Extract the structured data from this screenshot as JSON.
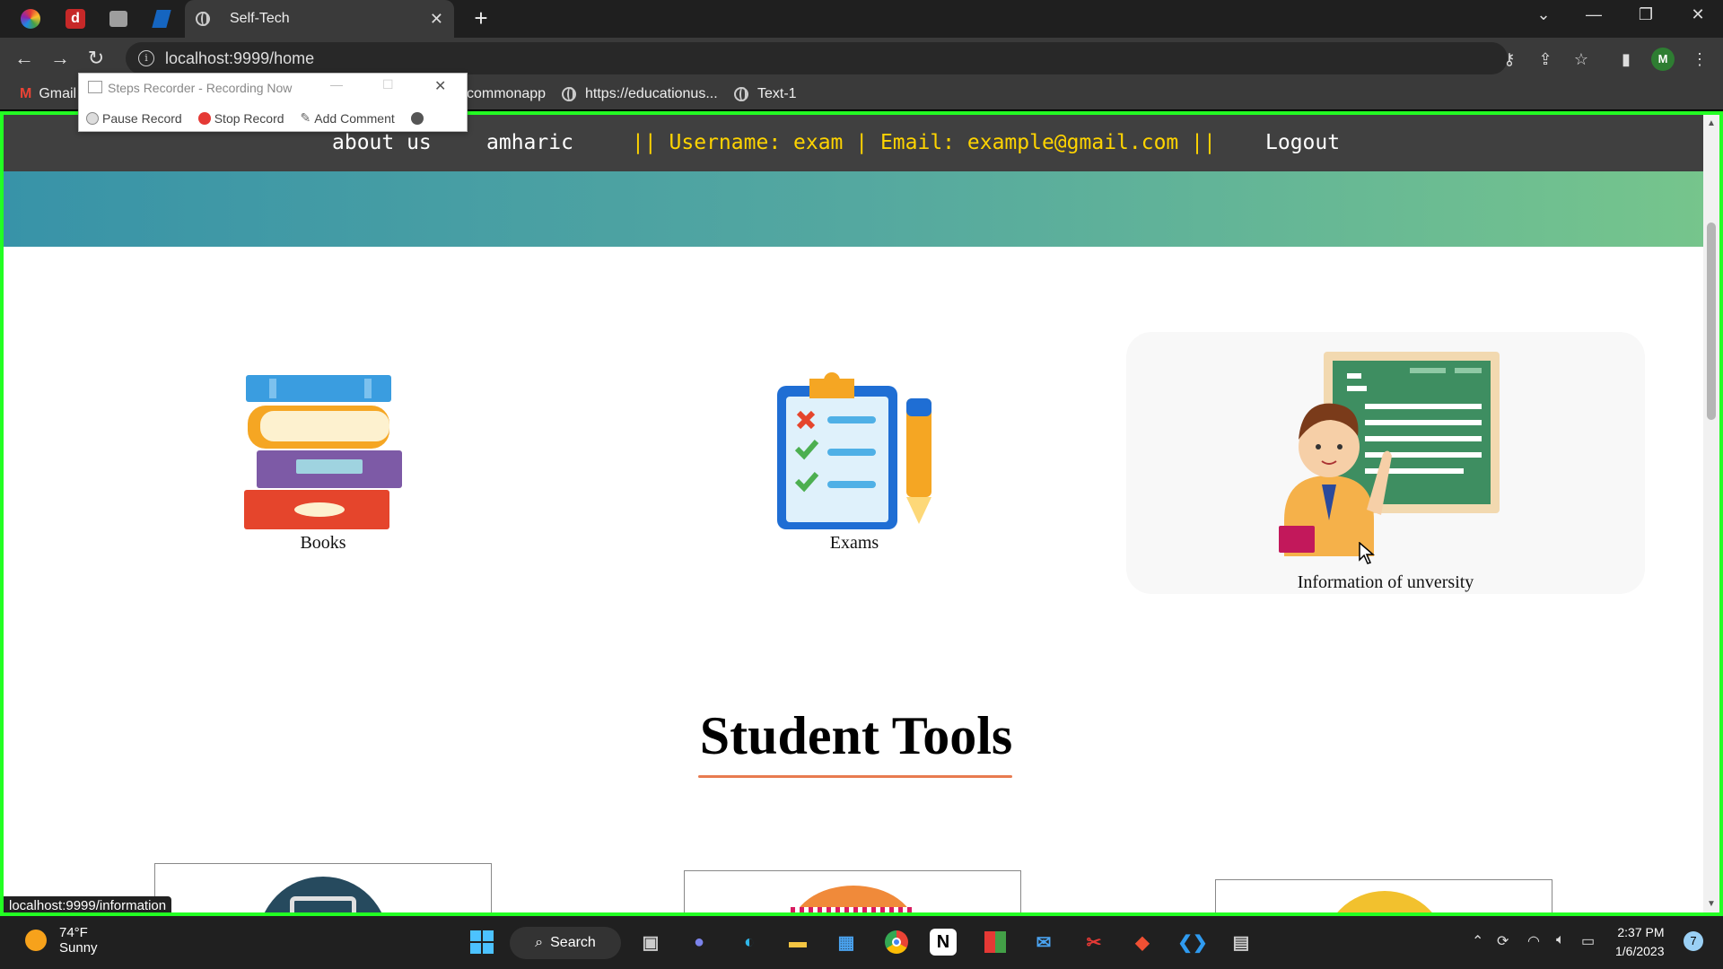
{
  "browser": {
    "active_tab_title": "Self-Tech",
    "url": "localhost:9999/home",
    "bookmarks": [
      "Gmail",
      "commonapp",
      "https://educationus...",
      "Text-1"
    ],
    "profile_initial": "M",
    "status_url": "localhost:9999/information"
  },
  "recorder": {
    "title": "Steps Recorder - Recording Now",
    "pause_label": "Pause Record",
    "stop_label": "Stop Record",
    "comment_label": "Add Comment"
  },
  "site_nav": {
    "about": "about us",
    "language": "amharic",
    "user_info": "|| Username: exam | Email: example@gmail.com ||",
    "logout": "Logout"
  },
  "cards": [
    {
      "label": "Books",
      "icon": "books-icon"
    },
    {
      "label": "Exams",
      "icon": "exam-clipboard-icon"
    },
    {
      "label": "Information of unversity",
      "icon": "teacher-board-icon"
    }
  ],
  "student_tools": {
    "title": "Student Tools"
  },
  "taskbar": {
    "weather_temp": "74°F",
    "weather_desc": "Sunny",
    "search_label": "Search",
    "time": "2:37 PM",
    "date": "1/6/2023",
    "notification_count": "7"
  },
  "colors": {
    "nav_bg": "#404040",
    "nav_user_text": "#ffd400",
    "banner_start": "#3893a8",
    "banner_end": "#76c58c",
    "title_underline": "#e87b4f",
    "highlight_border": "#23ff23"
  }
}
